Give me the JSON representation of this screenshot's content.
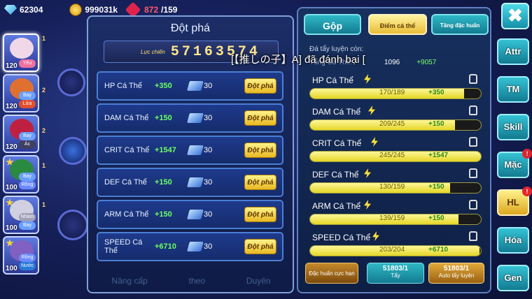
{
  "currencies": {
    "gems": "62304",
    "gold": "999031k",
    "stamina_current": "872",
    "stamina_max": "/159"
  },
  "pokemon_list": [
    {
      "level": "120",
      "tag": "Yếu",
      "tag_color": "#f070a0",
      "rank": "1",
      "art": "#f0d8e8"
    },
    {
      "level": "120",
      "tag": "Bay",
      "tag_color": "#6aa0ff",
      "tag2": "Lửa",
      "rank": "2",
      "art": "#e07030"
    },
    {
      "level": "120",
      "tag": "Bay",
      "tag_color": "#6aa0ff",
      "tag2": "Ác",
      "rank": "2",
      "art": "#c02040"
    },
    {
      "level": "100",
      "tag": "Bay",
      "tag_color": "#6aa0ff",
      "tag2": "Rồng",
      "rank": "1",
      "art": "#2a8a40"
    },
    {
      "level": "100",
      "tag": "Nhám",
      "tag_color": "#a0a0b8",
      "tag2": "Bay",
      "rank": "1",
      "art": "#d0d0e0"
    },
    {
      "level": "100",
      "tag": "Rồng",
      "tag_color": "#6a8aff",
      "tag2": "Nước",
      "rank": "",
      "art": "#8060c0"
    }
  ],
  "breakthrough": {
    "title": "Đột phá",
    "power_label": "Lực chiến",
    "power_value": "57163574",
    "rows": [
      {
        "label": "HP Cá Thể",
        "value": "+350",
        "cost": "30",
        "button": "Đột phá"
      },
      {
        "label": "DAM Cá Thể",
        "value": "+150",
        "cost": "30",
        "button": "Đột phá"
      },
      {
        "label": "CRIT Cá Thể",
        "value": "+1547",
        "cost": "30",
        "button": "Đột phá"
      },
      {
        "label": "DEF Cá Thể",
        "value": "+150",
        "cost": "30",
        "button": "Đột phá"
      },
      {
        "label": "ARM Cá Thể",
        "value": "+150",
        "cost": "30",
        "button": "Đột phá"
      },
      {
        "label": "SPEED Cá Thể",
        "value": "+6710",
        "cost": "30",
        "button": "Đột phá"
      }
    ],
    "bottom_tabs": [
      "Nâng cấp",
      "theo",
      "Duyên"
    ]
  },
  "marquee": "[【推しの子】A] đã đánh bại [",
  "right_panel": {
    "tabs": [
      "Gộp",
      "Điểm cá thể",
      "Tăng đặc huấn"
    ],
    "remaining_label": "Đá tẩy luyện còn:",
    "total_label": "Tổng Cá Thể:",
    "total_value": "1096",
    "total_gain": "+9057",
    "stats": [
      {
        "name": "HP Cá Thể",
        "count": "170/189",
        "gain": "+350",
        "fill": 0.9
      },
      {
        "name": "DAM Cá Thể",
        "count": "209/245",
        "gain": "+150",
        "fill": 0.85
      },
      {
        "name": "CRIT Cá Thể",
        "count": "245/245",
        "gain": "+1547",
        "fill": 1.0
      },
      {
        "name": "DEF Cá Thể",
        "count": "130/159",
        "gain": "+150",
        "fill": 0.82
      },
      {
        "name": "ARM Cá Thể",
        "count": "139/159",
        "gain": "+150",
        "fill": 0.87
      },
      {
        "name": "SPEED Cá Thể",
        "count": "203/204",
        "gain": "+6710",
        "fill": 0.99
      }
    ],
    "buttons": {
      "limit": "Đặc huấn cực hạn",
      "wash_count": "51803/1",
      "wash": "Tẩy",
      "auto_count": "51803/1",
      "auto": "Auto tẩy luyện"
    }
  },
  "side_tabs": [
    {
      "label": "Attr",
      "badge": ""
    },
    {
      "label": "TM",
      "badge": ""
    },
    {
      "label": "Skill",
      "badge": ""
    },
    {
      "label": "Mặc",
      "badge": "!"
    },
    {
      "label": "HL",
      "badge": "!",
      "active": true
    },
    {
      "label": "Hóa",
      "badge": ""
    },
    {
      "label": "Gen",
      "badge": ""
    }
  ],
  "close_label": "✖"
}
